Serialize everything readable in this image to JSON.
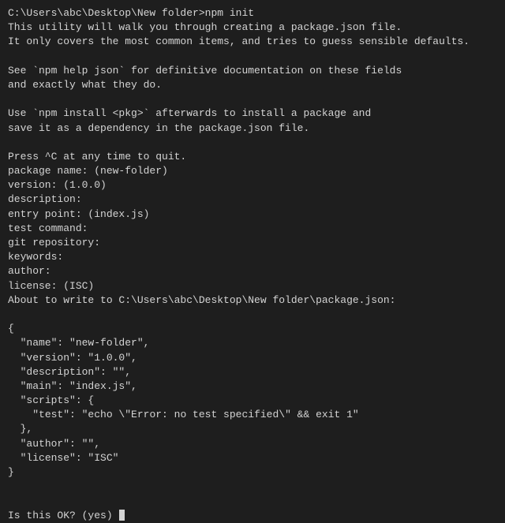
{
  "prompt": {
    "path": "C:\\Users\\abc\\Desktop\\New folder>",
    "command": "npm init"
  },
  "intro": {
    "l1": "This utility will walk you through creating a package.json file.",
    "l2": "It only covers the most common items, and tries to guess sensible defaults.",
    "l3": "",
    "l4": "See `npm help json` for definitive documentation on these fields",
    "l5": "and exactly what they do.",
    "l6": "",
    "l7": "Use `npm install <pkg>` afterwards to install a package and",
    "l8": "save it as a dependency in the package.json file.",
    "l9": "",
    "l10": "Press ^C at any time to quit."
  },
  "fields": {
    "package_name": "package name: (new-folder)",
    "version": "version: (1.0.0)",
    "description": "description:",
    "entry_point": "entry point: (index.js)",
    "test_command": "test command:",
    "git_repository": "git repository:",
    "keywords": "keywords:",
    "author": "author:",
    "license": "license: (ISC)"
  },
  "about_to_write": "About to write to C:\\Users\\abc\\Desktop\\New folder\\package.json:",
  "json_preview": {
    "open": "{",
    "name": "  \"name\": \"new-folder\",",
    "version": "  \"version\": \"1.0.0\",",
    "description": "  \"description\": \"\",",
    "main": "  \"main\": \"index.js\",",
    "scripts_open": "  \"scripts\": {",
    "test": "    \"test\": \"echo \\\"Error: no test specified\\\" && exit 1\"",
    "scripts_close": "  },",
    "author": "  \"author\": \"\",",
    "license": "  \"license\": \"ISC\"",
    "close": "}"
  },
  "confirm": {
    "prompt": "Is this OK? (yes) "
  }
}
